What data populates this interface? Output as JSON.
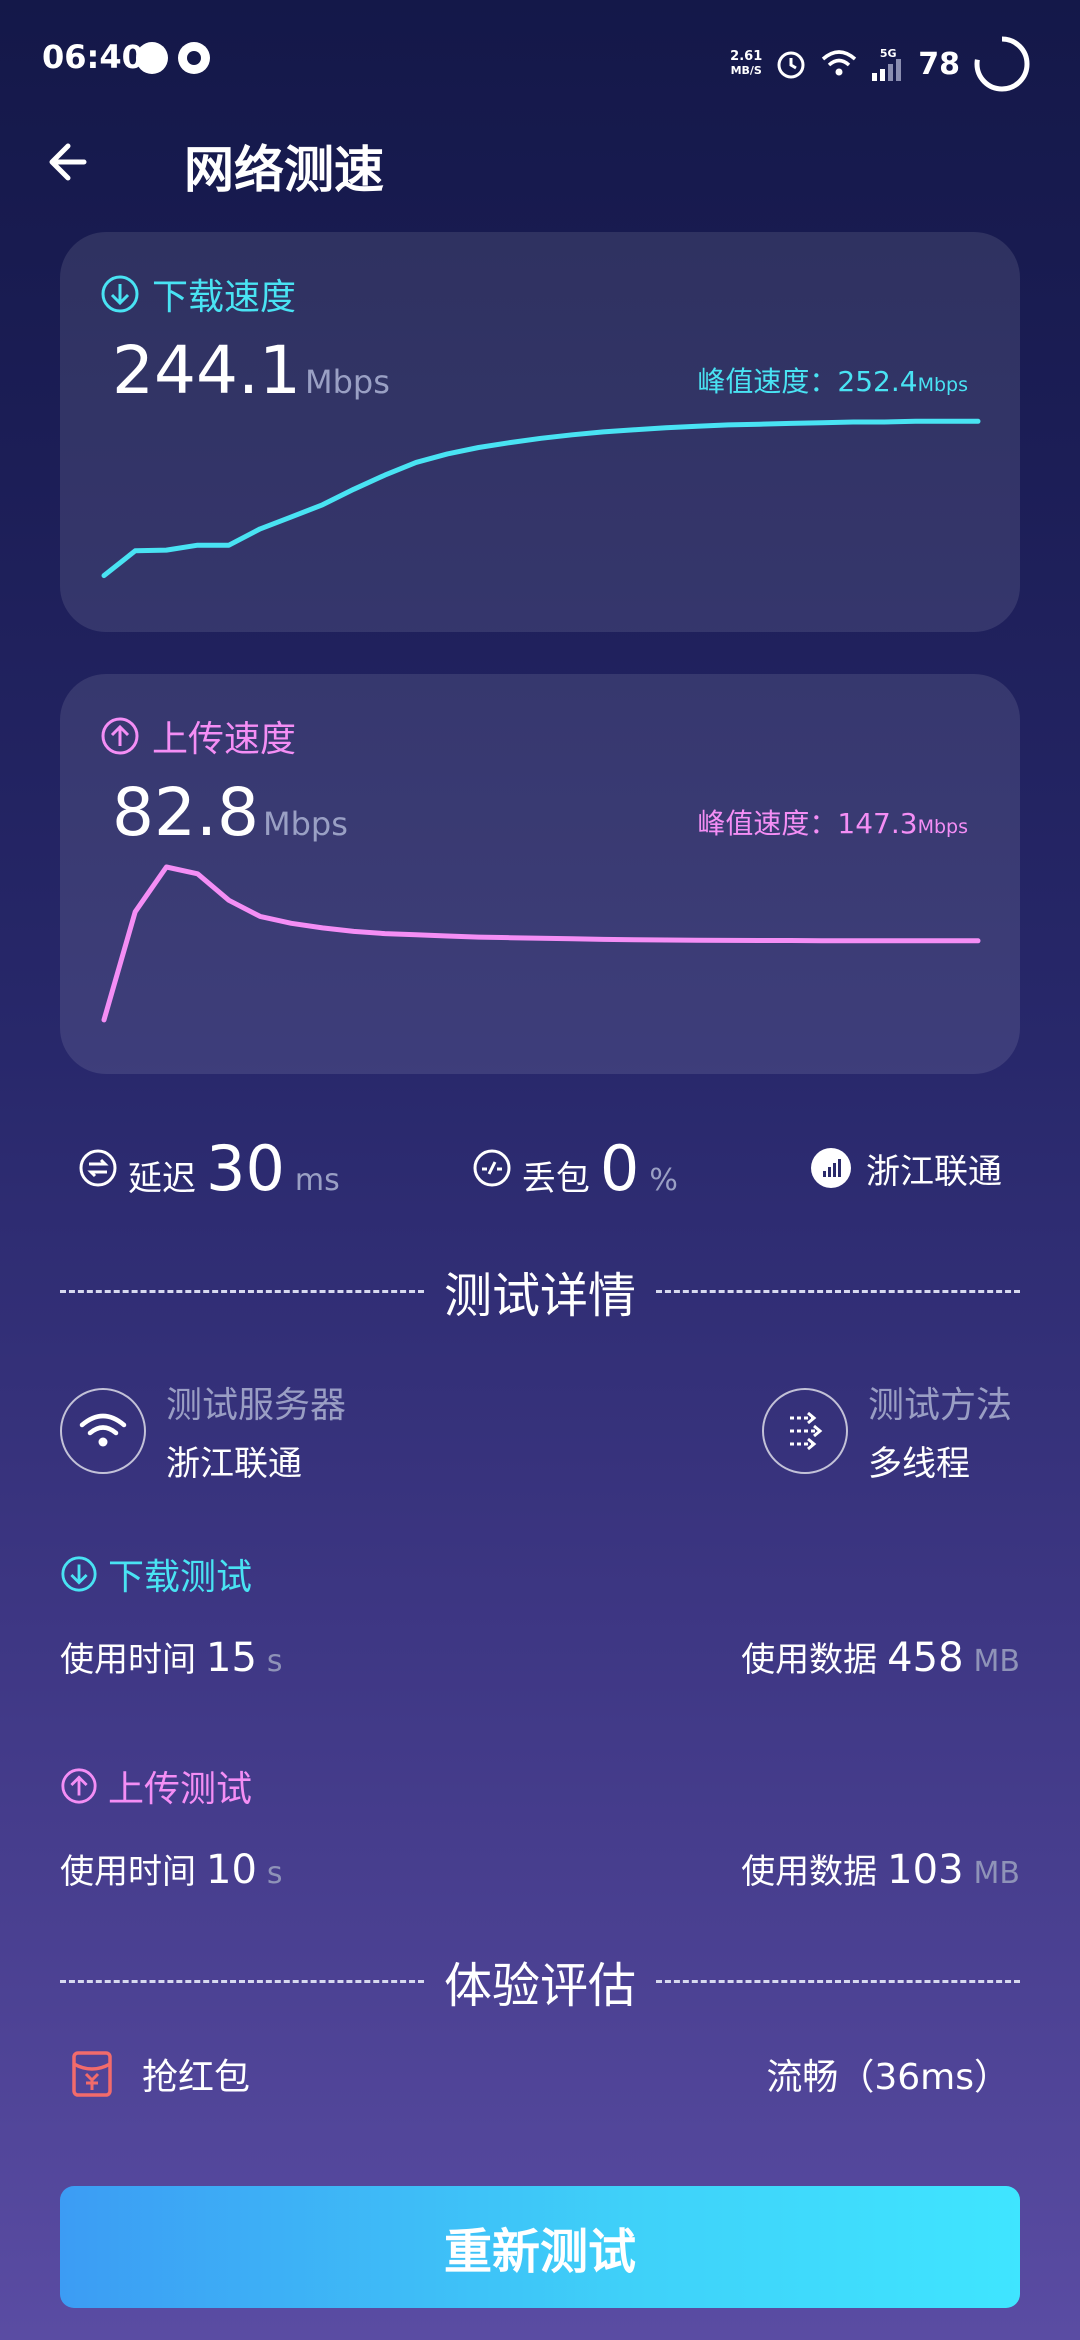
{
  "status_bar": {
    "time": "06:40",
    "net_speed_value": "2.61",
    "net_speed_unit": "MB/S",
    "network_type": "5G",
    "battery": "78"
  },
  "header": {
    "title": "网络测速"
  },
  "download": {
    "label": "下载速度",
    "value": "244.1",
    "unit": "Mbps",
    "peak_label": "峰值速度：",
    "peak_value": "252.4",
    "peak_unit": "Mbps"
  },
  "upload": {
    "label": "上传速度",
    "value": "82.8",
    "unit": "Mbps",
    "peak_label": "峰值速度：",
    "peak_value": "147.3",
    "peak_unit": "Mbps"
  },
  "chart_data": [
    {
      "type": "line",
      "series": [
        {
          "values": [
            26,
            61,
            62,
            69,
            69,
            92,
            109,
            126,
            148,
            168,
            186,
            198,
            207,
            214,
            220,
            225,
            229,
            232,
            235,
            237,
            239,
            240,
            241,
            242,
            243,
            243,
            244,
            244,
            244.1
          ]
        }
      ],
      "color": "#49e3f3",
      "ylim": [
        0,
        260
      ]
    },
    {
      "type": "line",
      "series": [
        {
          "values": [
            14,
            108,
            147,
            141,
            118,
            104,
            98,
            94,
            91,
            89,
            88,
            87,
            86,
            85.5,
            85,
            84.5,
            84,
            83.7,
            83.5,
            83.3,
            83.1,
            83,
            83,
            82.9,
            82.9,
            82.8,
            82.8,
            82.8,
            82.8
          ]
        }
      ],
      "color": "#f48ef5",
      "ylim": [
        0,
        160
      ]
    }
  ],
  "metrics": {
    "latency_label": "延迟",
    "latency_value": "30",
    "latency_unit": "ms",
    "loss_label": "丢包",
    "loss_value": "0",
    "loss_unit": "%",
    "isp": "浙江联通"
  },
  "details": {
    "title": "测试详情",
    "server_label": "测试服务器",
    "server_value": "浙江联通",
    "method_label": "测试方法",
    "method_value": "多线程",
    "download_test": {
      "label": "下载测试",
      "time_label": "使用时间",
      "time_value": "15",
      "time_unit": "s",
      "data_label": "使用数据",
      "data_value": "458",
      "data_unit": "MB"
    },
    "upload_test": {
      "label": "上传测试",
      "time_label": "使用时间",
      "time_value": "10",
      "time_unit": "s",
      "data_label": "使用数据",
      "data_value": "103",
      "data_unit": "MB"
    }
  },
  "evaluation": {
    "title": "体验评估",
    "item_label": "抢红包",
    "item_value": "流畅（36ms）"
  },
  "retest_button": "重新测试"
}
